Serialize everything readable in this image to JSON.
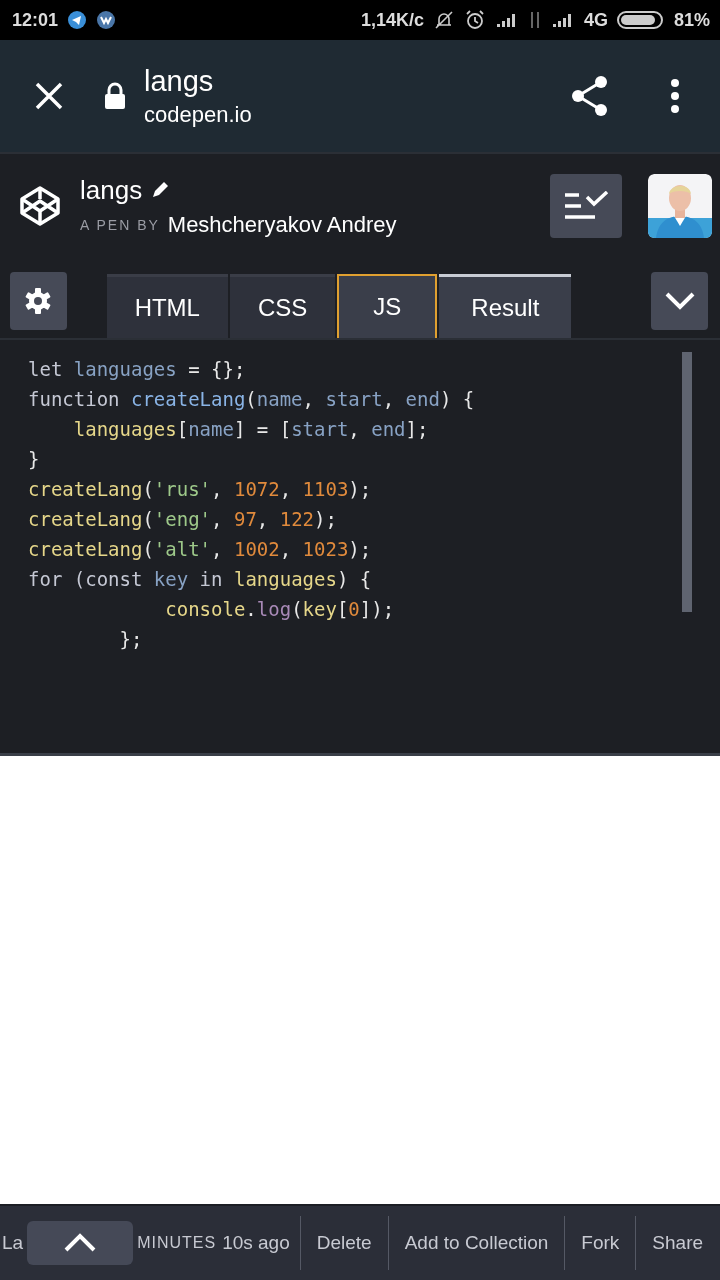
{
  "status_bar": {
    "time": "12:01",
    "speed": "1,14K/c",
    "network": "4G",
    "battery": "81%"
  },
  "browser_bar": {
    "title": "langs",
    "domain": "codepen.io"
  },
  "pen": {
    "title": "langs",
    "byline": "A PEN BY",
    "author": "Meshcheryakov Andrey"
  },
  "tabs": [
    {
      "label": "HTML",
      "selected": false
    },
    {
      "label": "CSS",
      "selected": false
    },
    {
      "label": "JS",
      "selected": true
    },
    {
      "label": "Result",
      "selected": false
    }
  ],
  "code": [
    [
      {
        "text": "let ",
        "kind": "keyword"
      },
      {
        "text": "languages",
        "kind": "variable"
      },
      {
        "text": " = {};",
        "kind": "plain"
      }
    ],
    [
      {
        "text": "function ",
        "kind": "keyword"
      },
      {
        "text": "createLang",
        "kind": "definition"
      },
      {
        "text": "(",
        "kind": "plain"
      },
      {
        "text": "name",
        "kind": "variable"
      },
      {
        "text": ", ",
        "kind": "plain"
      },
      {
        "text": "start",
        "kind": "variable"
      },
      {
        "text": ", ",
        "kind": "plain"
      },
      {
        "text": "end",
        "kind": "variable"
      },
      {
        "text": ") {",
        "kind": "plain"
      }
    ],
    [
      {
        "text": "    languages",
        "kind": "identifier"
      },
      {
        "text": "[",
        "kind": "plain"
      },
      {
        "text": "name",
        "kind": "variable"
      },
      {
        "text": "] = [",
        "kind": "plain"
      },
      {
        "text": "start",
        "kind": "variable"
      },
      {
        "text": ", ",
        "kind": "plain"
      },
      {
        "text": "end",
        "kind": "variable"
      },
      {
        "text": "];",
        "kind": "plain"
      }
    ],
    [
      {
        "text": "}",
        "kind": "plain"
      }
    ],
    [
      {
        "text": "createLang",
        "kind": "identifier"
      },
      {
        "text": "(",
        "kind": "plain"
      },
      {
        "text": "'rus'",
        "kind": "string"
      },
      {
        "text": ", ",
        "kind": "plain"
      },
      {
        "text": "1072",
        "kind": "number"
      },
      {
        "text": ", ",
        "kind": "plain"
      },
      {
        "text": "1103",
        "kind": "number"
      },
      {
        "text": ");",
        "kind": "plain"
      }
    ],
    [
      {
        "text": "createLang",
        "kind": "identifier"
      },
      {
        "text": "(",
        "kind": "plain"
      },
      {
        "text": "'eng'",
        "kind": "string"
      },
      {
        "text": ", ",
        "kind": "plain"
      },
      {
        "text": "97",
        "kind": "number"
      },
      {
        "text": ", ",
        "kind": "plain"
      },
      {
        "text": "122",
        "kind": "number"
      },
      {
        "text": ");",
        "kind": "plain"
      }
    ],
    [
      {
        "text": "createLang",
        "kind": "identifier"
      },
      {
        "text": "(",
        "kind": "plain"
      },
      {
        "text": "'alt'",
        "kind": "string"
      },
      {
        "text": ", ",
        "kind": "plain"
      },
      {
        "text": "1002",
        "kind": "number"
      },
      {
        "text": ", ",
        "kind": "plain"
      },
      {
        "text": "1023",
        "kind": "number"
      },
      {
        "text": ");",
        "kind": "plain"
      }
    ],
    [
      {
        "text": "for (",
        "kind": "keyword"
      },
      {
        "text": "const ",
        "kind": "keyword"
      },
      {
        "text": "key ",
        "kind": "variable"
      },
      {
        "text": "in ",
        "kind": "keyword"
      },
      {
        "text": "languages",
        "kind": "identifier"
      },
      {
        "text": ") {",
        "kind": "plain"
      }
    ],
    [
      {
        "text": "            console",
        "kind": "identifier"
      },
      {
        "text": ".",
        "kind": "plain"
      },
      {
        "text": "log",
        "kind": "property"
      },
      {
        "text": "(",
        "kind": "plain"
      },
      {
        "text": "key",
        "kind": "identifier"
      },
      {
        "text": "[",
        "kind": "plain"
      },
      {
        "text": "0",
        "kind": "number"
      },
      {
        "text": "]);",
        "kind": "plain"
      }
    ],
    [
      {
        "text": "        };",
        "kind": "plain"
      }
    ]
  ],
  "footer": {
    "cut_text": "La",
    "minutes": "MINUTES",
    "time": "10s ago",
    "actions": [
      "Delete",
      "Add to Collection",
      "Fork",
      "Share"
    ]
  }
}
